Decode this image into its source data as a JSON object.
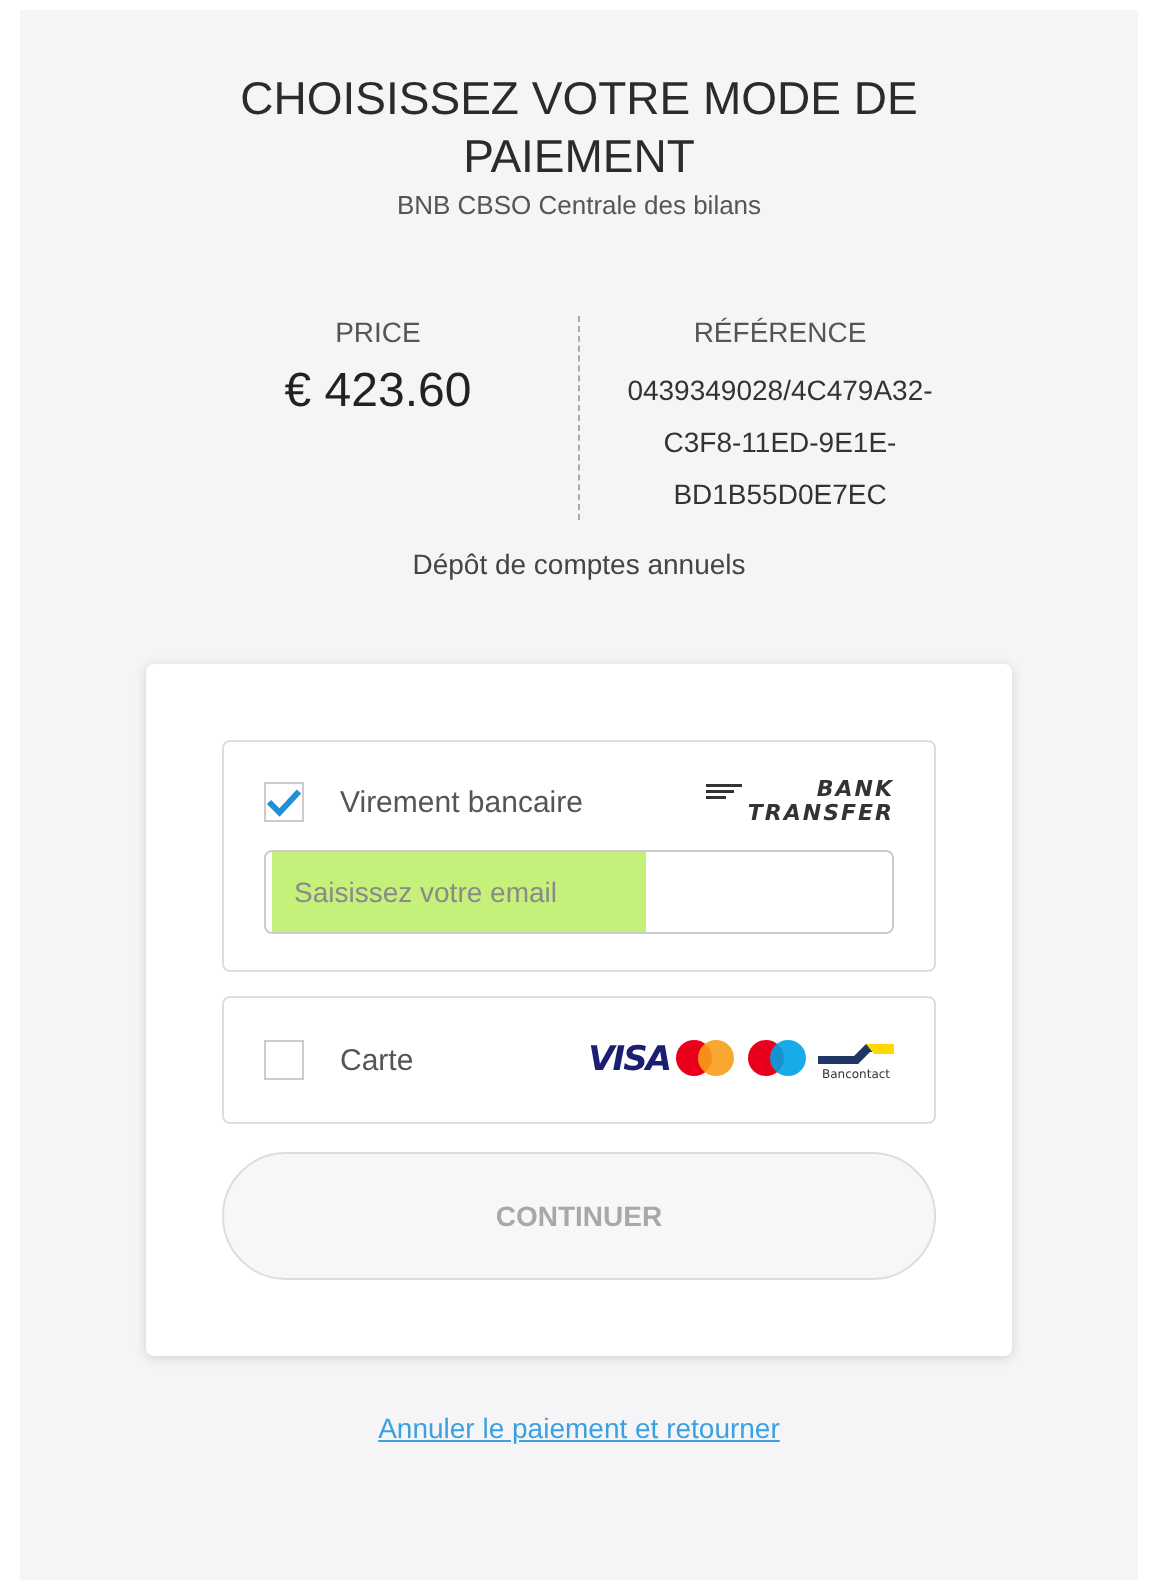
{
  "header": {
    "title": "CHOISISSEZ VOTRE MODE DE PAIEMENT",
    "subtitle": "BNB CBSO Centrale des bilans"
  },
  "summary": {
    "price_label": "PRICE",
    "price": "€ 423.60",
    "reference_label": "RÉFÉRENCE",
    "reference": "0439349028/4C479A32-C3F8-11ED-9E1E-BD1B55D0E7EC"
  },
  "description": "Dépôt de comptes annuels",
  "methods": [
    {
      "kind": "bank",
      "label": "Virement bancaire",
      "checked": true,
      "logo_lines": [
        "BANK",
        "TRANSFER"
      ],
      "email_field": {
        "placeholder": "Saisissez votre email",
        "highlighted": true
      }
    },
    {
      "kind": "card",
      "label": "Carte",
      "checked": false,
      "logos": {
        "visa": "VISA",
        "bancontact": "Bancontact"
      }
    }
  ],
  "continue_button": {
    "label": "CONTINUER",
    "disabled": true
  },
  "cancel_link": "Annuler le paiement et retourner"
}
